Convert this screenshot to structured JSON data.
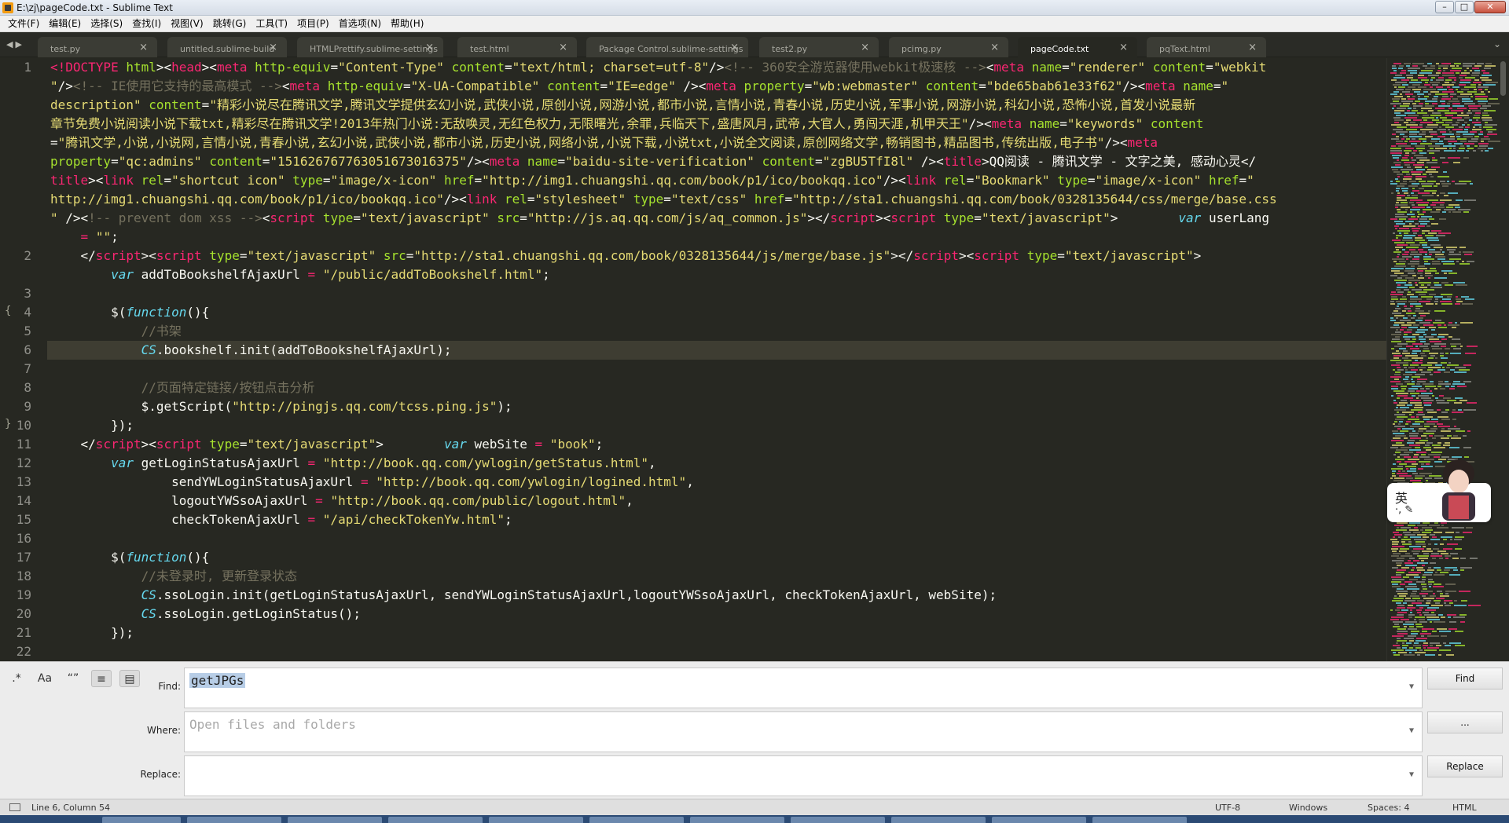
{
  "window": {
    "title": "E:\\zj\\pageCode.txt - Sublime Text"
  },
  "menu": [
    "文件(F)",
    "编辑(E)",
    "选择(S)",
    "查找(I)",
    "视图(V)",
    "跳转(G)",
    "工具(T)",
    "项目(P)",
    "首选项(N)",
    "帮助(H)"
  ],
  "tabs": [
    {
      "label": "test.py",
      "active": false
    },
    {
      "label": "untitled.sublime-build",
      "active": false
    },
    {
      "label": "HTMLPrettify.sublime-settings",
      "active": false
    },
    {
      "label": "test.html",
      "active": false
    },
    {
      "label": "Package Control.sublime-settings",
      "active": false
    },
    {
      "label": "test2.py",
      "active": false
    },
    {
      "label": "pcimg.py",
      "active": false
    },
    {
      "label": "pageCode.txt",
      "active": true
    },
    {
      "label": "pqText.html",
      "active": false
    }
  ],
  "tab_close_glyph": "×",
  "editor": {
    "line_numbers": [
      "1",
      "2",
      "3",
      "4",
      "5",
      "6",
      "7",
      "8",
      "9",
      "10",
      "11",
      "12",
      "13",
      "14",
      "15",
      "16",
      "17",
      "18",
      "19",
      "20",
      "21",
      "22"
    ],
    "code": [
      [
        [
          "t",
          "<!DOCTYPE"
        ],
        [
          "w",
          " "
        ],
        [
          "a",
          "html"
        ],
        [
          "w",
          "><"
        ],
        [
          "t",
          "head"
        ],
        [
          "w",
          "><"
        ],
        [
          "t",
          "meta"
        ],
        [
          "w",
          " "
        ],
        [
          "a",
          "http-equiv"
        ],
        [
          "w",
          "="
        ],
        [
          "s",
          "\"Content-Type\""
        ],
        [
          "w",
          " "
        ],
        [
          "a",
          "content"
        ],
        [
          "w",
          "="
        ],
        [
          "s",
          "\"text/html; charset=utf-8\""
        ],
        [
          "w",
          "/>"
        ],
        [
          "c",
          "<!-- 360安全游览器使用webkit极速核 -->"
        ],
        [
          "w",
          "<"
        ],
        [
          "t",
          "meta"
        ],
        [
          "w",
          " "
        ],
        [
          "a",
          "name"
        ],
        [
          "w",
          "="
        ],
        [
          "s",
          "\"renderer\""
        ],
        [
          "w",
          " "
        ],
        [
          "a",
          "content"
        ],
        [
          "w",
          "="
        ],
        [
          "s",
          "\"webkit"
        ]
      ],
      [
        [
          "s",
          "\""
        ],
        [
          "w",
          "/>"
        ],
        [
          "c",
          "<!-- IE使用它支持的最高模式 -->"
        ],
        [
          "w",
          "<"
        ],
        [
          "t",
          "meta"
        ],
        [
          "w",
          " "
        ],
        [
          "a",
          "http-equiv"
        ],
        [
          "w",
          "="
        ],
        [
          "s",
          "\"X-UA-Compatible\""
        ],
        [
          "w",
          " "
        ],
        [
          "a",
          "content"
        ],
        [
          "w",
          "="
        ],
        [
          "s",
          "\"IE=edge\""
        ],
        [
          "w",
          " /><"
        ],
        [
          "t",
          "meta"
        ],
        [
          "w",
          " "
        ],
        [
          "a",
          "property"
        ],
        [
          "w",
          "="
        ],
        [
          "s",
          "\"wb:webmaster\""
        ],
        [
          "w",
          " "
        ],
        [
          "a",
          "content"
        ],
        [
          "w",
          "="
        ],
        [
          "s",
          "\"bde65bab61e33f62\""
        ],
        [
          "w",
          "/><"
        ],
        [
          "t",
          "meta"
        ],
        [
          "w",
          " "
        ],
        [
          "a",
          "name"
        ],
        [
          "w",
          "="
        ],
        [
          "s",
          "\""
        ]
      ],
      [
        [
          "s",
          "description\""
        ],
        [
          "w",
          " "
        ],
        [
          "a",
          "content"
        ],
        [
          "w",
          "="
        ],
        [
          "s",
          "\"精彩小说尽在腾讯文学,腾讯文学提供玄幻小说,武侠小说,原创小说,网游小说,都市小说,言情小说,青春小说,历史小说,军事小说,网游小说,科幻小说,恐怖小说,首发小说最新"
        ]
      ],
      [
        [
          "s",
          "章节免费小说阅读小说下载txt,精彩尽在腾讯文学!2013年热门小说:无敌唤灵,无红色权力,无限曙光,余罪,兵临天下,盛唐风月,武帝,大官人,勇闯天涯,机甲天王\""
        ],
        [
          "w",
          "/><"
        ],
        [
          "t",
          "meta"
        ],
        [
          "w",
          " "
        ],
        [
          "a",
          "name"
        ],
        [
          "w",
          "="
        ],
        [
          "s",
          "\"keywords\""
        ],
        [
          "w",
          " "
        ],
        [
          "a",
          "content"
        ]
      ],
      [
        [
          "w",
          "="
        ],
        [
          "s",
          "\"腾讯文学,小说,小说网,言情小说,青春小说,玄幻小说,武侠小说,都市小说,历史小说,网络小说,小说下载,小说txt,小说全文阅读,原创网络文学,畅销图书,精品图书,传统出版,电子书\""
        ],
        [
          "w",
          "/><"
        ],
        [
          "t",
          "meta"
        ]
      ],
      [
        [
          "a",
          "property"
        ],
        [
          "w",
          "="
        ],
        [
          "s",
          "\"qc:admins\""
        ],
        [
          "w",
          " "
        ],
        [
          "a",
          "content"
        ],
        [
          "w",
          "="
        ],
        [
          "s",
          "\"151626767763051673016375\""
        ],
        [
          "w",
          "/><"
        ],
        [
          "t",
          "meta"
        ],
        [
          "w",
          " "
        ],
        [
          "a",
          "name"
        ],
        [
          "w",
          "="
        ],
        [
          "s",
          "\"baidu-site-verification\""
        ],
        [
          "w",
          " "
        ],
        [
          "a",
          "content"
        ],
        [
          "w",
          "="
        ],
        [
          "s",
          "\"zgBU5TfI8l\""
        ],
        [
          "w",
          " /><"
        ],
        [
          "t",
          "title"
        ],
        [
          "w",
          ">QQ阅读 - 腾讯文学 - 文字之美, 感动心灵</"
        ]
      ],
      [
        [
          "t",
          "title"
        ],
        [
          "w",
          "><"
        ],
        [
          "t",
          "link"
        ],
        [
          "w",
          " "
        ],
        [
          "a",
          "rel"
        ],
        [
          "w",
          "="
        ],
        [
          "s",
          "\"shortcut icon\""
        ],
        [
          "w",
          " "
        ],
        [
          "a",
          "type"
        ],
        [
          "w",
          "="
        ],
        [
          "s",
          "\"image/x-icon\""
        ],
        [
          "w",
          " "
        ],
        [
          "a",
          "href"
        ],
        [
          "w",
          "="
        ],
        [
          "s",
          "\"http://img1.chuangshi.qq.com/book/p1/ico/bookqq.ico\""
        ],
        [
          "w",
          "/><"
        ],
        [
          "t",
          "link"
        ],
        [
          "w",
          " "
        ],
        [
          "a",
          "rel"
        ],
        [
          "w",
          "="
        ],
        [
          "s",
          "\"Bookmark\""
        ],
        [
          "w",
          " "
        ],
        [
          "a",
          "type"
        ],
        [
          "w",
          "="
        ],
        [
          "s",
          "\"image/x-icon\""
        ],
        [
          "w",
          " "
        ],
        [
          "a",
          "href"
        ],
        [
          "w",
          "="
        ],
        [
          "s",
          "\""
        ]
      ],
      [
        [
          "s",
          "http://img1.chuangshi.qq.com/book/p1/ico/bookqq.ico\""
        ],
        [
          "w",
          "/><"
        ],
        [
          "t",
          "link"
        ],
        [
          "w",
          " "
        ],
        [
          "a",
          "rel"
        ],
        [
          "w",
          "="
        ],
        [
          "s",
          "\"stylesheet\""
        ],
        [
          "w",
          " "
        ],
        [
          "a",
          "type"
        ],
        [
          "w",
          "="
        ],
        [
          "s",
          "\"text/css\""
        ],
        [
          "w",
          " "
        ],
        [
          "a",
          "href"
        ],
        [
          "w",
          "="
        ],
        [
          "s",
          "\"http://sta1.chuangshi.qq.com/book/0328135644/css/merge/base.css"
        ]
      ],
      [
        [
          "s",
          "\""
        ],
        [
          "w",
          " /><"
        ],
        [
          "c",
          "!-- prevent dom xss -->"
        ],
        [
          "w",
          "<"
        ],
        [
          "t",
          "script"
        ],
        [
          "w",
          " "
        ],
        [
          "a",
          "type"
        ],
        [
          "w",
          "="
        ],
        [
          "s",
          "\"text/javascript\""
        ],
        [
          "w",
          " "
        ],
        [
          "a",
          "src"
        ],
        [
          "w",
          "="
        ],
        [
          "s",
          "\"http://js.aq.qq.com/js/aq_common.js\""
        ],
        [
          "w",
          "></"
        ],
        [
          "t",
          "script"
        ],
        [
          "w",
          "><"
        ],
        [
          "t",
          "script"
        ],
        [
          "w",
          " "
        ],
        [
          "a",
          "type"
        ],
        [
          "w",
          "="
        ],
        [
          "s",
          "\"text/javascript\""
        ],
        [
          "w",
          ">        "
        ],
        [
          "k",
          "var"
        ],
        [
          "w",
          " userLang"
        ]
      ],
      [
        [
          "w",
          "    "
        ],
        [
          "t",
          "="
        ],
        [
          "w",
          " "
        ],
        [
          "s",
          "\"\""
        ],
        [
          "w",
          ";"
        ]
      ],
      [
        [
          "w",
          "    </"
        ],
        [
          "t",
          "script"
        ],
        [
          "w",
          "><"
        ],
        [
          "t",
          "script"
        ],
        [
          "w",
          " "
        ],
        [
          "a",
          "type"
        ],
        [
          "w",
          "="
        ],
        [
          "s",
          "\"text/javascript\""
        ],
        [
          "w",
          " "
        ],
        [
          "a",
          "src"
        ],
        [
          "w",
          "="
        ],
        [
          "s",
          "\"http://sta1.chuangshi.qq.com/book/0328135644/js/merge/base.js\""
        ],
        [
          "w",
          "></"
        ],
        [
          "t",
          "script"
        ],
        [
          "w",
          "><"
        ],
        [
          "t",
          "script"
        ],
        [
          "w",
          " "
        ],
        [
          "a",
          "type"
        ],
        [
          "w",
          "="
        ],
        [
          "s",
          "\"text/javascript\""
        ],
        [
          "w",
          ">"
        ]
      ],
      [
        [
          "w",
          "        "
        ],
        [
          "k",
          "var"
        ],
        [
          "w",
          " addToBookshelfAjaxUrl "
        ],
        [
          "t",
          "="
        ],
        [
          "w",
          " "
        ],
        [
          "s",
          "\"/public/addToBookshelf.html\""
        ],
        [
          "w",
          ";"
        ]
      ],
      [
        [
          "w",
          ""
        ]
      ],
      [
        [
          "w",
          "        $("
        ],
        [
          "k",
          "function"
        ],
        [
          "w",
          "(){"
        ]
      ],
      [
        [
          "w",
          "            "
        ],
        [
          "c",
          "//书架"
        ]
      ],
      [
        [
          "w",
          "            "
        ],
        [
          "k",
          "CS"
        ],
        [
          "w",
          ".bookshelf.init(addToBookshelfAjaxUrl);"
        ]
      ],
      [
        [
          "w",
          ""
        ]
      ],
      [
        [
          "w",
          "            "
        ],
        [
          "c",
          "//页面特定链接/按钮点击分析"
        ]
      ],
      [
        [
          "w",
          "            $.getScript("
        ],
        [
          "s",
          "\"http://pingjs.qq.com/tcss.ping.js\""
        ],
        [
          "w",
          ");"
        ]
      ],
      [
        [
          "w",
          "        });"
        ]
      ],
      [
        [
          "w",
          "    </"
        ],
        [
          "t",
          "script"
        ],
        [
          "w",
          "><"
        ],
        [
          "t",
          "script"
        ],
        [
          "w",
          " "
        ],
        [
          "a",
          "type"
        ],
        [
          "w",
          "="
        ],
        [
          "s",
          "\"text/javascript\""
        ],
        [
          "w",
          ">        "
        ],
        [
          "k",
          "var"
        ],
        [
          "w",
          " webSite "
        ],
        [
          "t",
          "="
        ],
        [
          "w",
          " "
        ],
        [
          "s",
          "\"book\""
        ],
        [
          "w",
          ";"
        ]
      ],
      [
        [
          "w",
          "        "
        ],
        [
          "k",
          "var"
        ],
        [
          "w",
          " getLoginStatusAjaxUrl "
        ],
        [
          "t",
          "="
        ],
        [
          "w",
          " "
        ],
        [
          "s",
          "\"http://book.qq.com/ywlogin/getStatus.html\""
        ],
        [
          "w",
          ","
        ]
      ],
      [
        [
          "w",
          "                sendYWLoginStatusAjaxUrl "
        ],
        [
          "t",
          "="
        ],
        [
          "w",
          " "
        ],
        [
          "s",
          "\"http://book.qq.com/ywlogin/logined.html\""
        ],
        [
          "w",
          ","
        ]
      ],
      [
        [
          "w",
          "                logoutYWSsoAjaxUrl "
        ],
        [
          "t",
          "="
        ],
        [
          "w",
          " "
        ],
        [
          "s",
          "\"http://book.qq.com/public/logout.html\""
        ],
        [
          "w",
          ","
        ]
      ],
      [
        [
          "w",
          "                checkTokenAjaxUrl "
        ],
        [
          "t",
          "="
        ],
        [
          "w",
          " "
        ],
        [
          "s",
          "\"/api/checkTokenYw.html\""
        ],
        [
          "w",
          ";"
        ]
      ],
      [
        [
          "w",
          ""
        ]
      ],
      [
        [
          "w",
          "        $("
        ],
        [
          "k",
          "function"
        ],
        [
          "w",
          "(){"
        ]
      ],
      [
        [
          "w",
          "            "
        ],
        [
          "c",
          "//未登录时, 更新登录状态"
        ]
      ],
      [
        [
          "w",
          "            "
        ],
        [
          "k",
          "CS"
        ],
        [
          "w",
          ".ssoLogin.init(getLoginStatusAjaxUrl, sendYWLoginStatusAjaxUrl,logoutYWSsoAjaxUrl, checkTokenAjaxUrl, webSite);"
        ]
      ],
      [
        [
          "w",
          "            "
        ],
        [
          "k",
          "CS"
        ],
        [
          "w",
          ".ssoLogin.getLoginStatus();"
        ]
      ],
      [
        [
          "w",
          "        });"
        ]
      ],
      [
        [
          "w",
          ""
        ]
      ]
    ]
  },
  "find_panel": {
    "options": [
      ".*",
      "Aa",
      "“”",
      "≡",
      "▤"
    ],
    "find_label": "Find:",
    "find_value": "getJPGs",
    "where_label": "Where:",
    "where_placeholder": "Open files and folders",
    "replace_label": "Replace:",
    "replace_value": "",
    "find_button": "Find",
    "where_button": "...",
    "replace_button": "Replace"
  },
  "status_bar": {
    "position": "Line 6, Column 54",
    "encoding": "UTF-8",
    "line_endings": "Windows",
    "indent": "Spaces: 4",
    "syntax": "HTML"
  },
  "ime": {
    "label": "英",
    "sub": "·, ✎"
  },
  "colors": {
    "tag": "#f92672",
    "attr": "#a6e22e",
    "string": "#e6db74",
    "comment": "#75715e",
    "keyword": "#66d9ef",
    "bg": "#272822"
  }
}
